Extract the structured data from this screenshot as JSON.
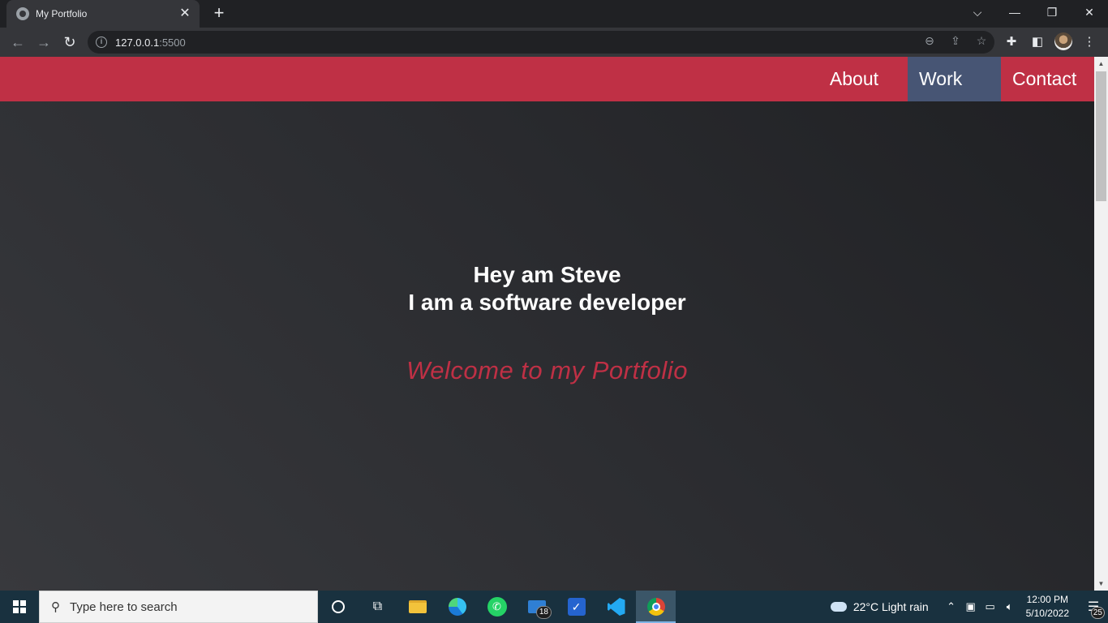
{
  "browser": {
    "tab_title": "My Portfolio",
    "tab_close": "✕",
    "new_tab": "+",
    "url_host": "127.0.0.1",
    "url_port": ":5500",
    "window_controls": [
      "⌵",
      "—",
      "❐",
      "✕"
    ]
  },
  "site": {
    "nav": {
      "about": "About",
      "work": "Work",
      "contact": "Contact"
    },
    "hero": {
      "line1": "Hey am Steve",
      "line2": "I am a software developer",
      "welcome": "Welcome to my Portfolio"
    },
    "colors": {
      "accent": "#bf3045",
      "work_highlight": "#475574"
    }
  },
  "taskbar": {
    "search_placeholder": "Type here to search",
    "mail_badge": "18",
    "weather": "22°C  Light rain",
    "time": "12:00 PM",
    "date": "5/10/2022",
    "notification_count": "25"
  }
}
